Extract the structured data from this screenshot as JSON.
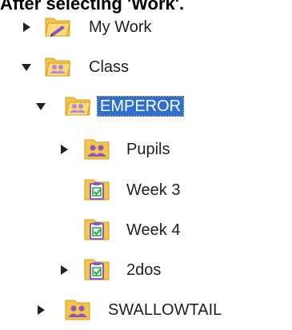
{
  "caption": "After selecting 'Work'.",
  "tree": {
    "items": [
      {
        "label": "My Work",
        "expanded": false,
        "icon": "my-work-folder-icon"
      },
      {
        "label": "Class",
        "expanded": true,
        "icon": "class-folder-icon"
      },
      {
        "label": "EMPEROR",
        "expanded": true,
        "selected": true,
        "icon": "class-folder-icon"
      },
      {
        "label": "Pupils",
        "expanded": false,
        "icon": "pupils-folder-icon"
      },
      {
        "label": "Week 3",
        "icon": "task-folder-icon"
      },
      {
        "label": "Week 4",
        "icon": "task-folder-icon"
      },
      {
        "label": "2dos",
        "expanded": false,
        "icon": "task-folder-icon"
      },
      {
        "label": "SWALLOWTAIL",
        "expanded": false,
        "icon": "pupils-folder-icon"
      }
    ]
  },
  "colors": {
    "selection": "#2f6fd0",
    "folder_yellow": "#f3c54a",
    "folder_purple": "#8a58c4",
    "check_green": "#2aa44a"
  }
}
